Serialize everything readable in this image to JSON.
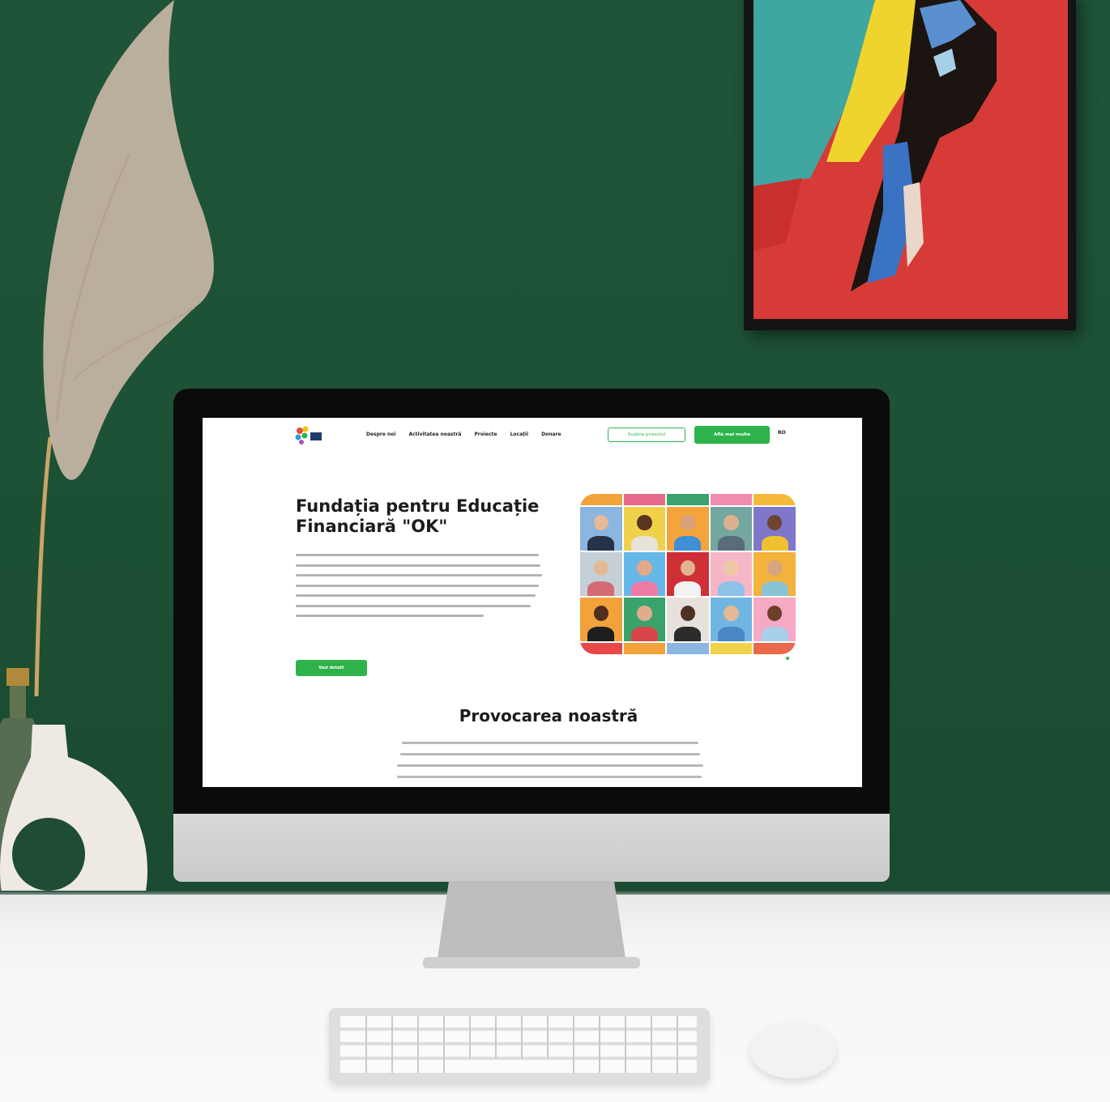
{
  "site": {
    "nav": {
      "items": [
        "Despre noi",
        "Activitatea noastră",
        "Proiecte",
        "Locații",
        "Donare"
      ],
      "support_label": "Susține proiectul",
      "donate_label": "Află mai multe",
      "language": "RO"
    },
    "hero": {
      "title": "Fundația pentru Educație Financiară \"OK\"",
      "cta_label": "Vezi detalii"
    },
    "section": {
      "title": "Provocarea noastră"
    }
  },
  "colors": {
    "brand_green": "#2db34a",
    "wall_green": "#1f5438",
    "painting_red": "#d33a35"
  }
}
